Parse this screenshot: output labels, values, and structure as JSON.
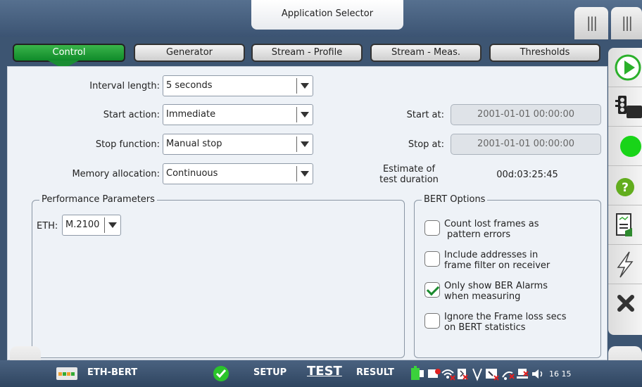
{
  "header": {
    "app_selector_label": "Application Selector",
    "grip_glyph": "|||"
  },
  "tabs": [
    {
      "label": "Control",
      "active": true
    },
    {
      "label": "Generator",
      "active": false
    },
    {
      "label": "Stream - Profile",
      "active": false
    },
    {
      "label": "Stream - Meas.",
      "active": false
    },
    {
      "label": "Thresholds",
      "active": false
    }
  ],
  "form": {
    "interval": {
      "label": "Interval length:",
      "value": "5 seconds"
    },
    "start_action": {
      "label": "Start action:",
      "value": "Immediate"
    },
    "stop_function": {
      "label": "Stop function:",
      "value": "Manual stop"
    },
    "memory": {
      "label": "Memory allocation:",
      "value": "Continuous"
    },
    "start_at": {
      "label": "Start at:",
      "value": "2001-01-01 00:00:00"
    },
    "stop_at": {
      "label": "Stop at:",
      "value": "2001-01-01 00:00:00"
    },
    "estimate": {
      "label_line1": "Estimate of",
      "label_line2": "test duration",
      "value": "00d:03:25:45"
    }
  },
  "performance": {
    "title": "Performance Parameters",
    "eth_label": "ETH:",
    "eth_value": "M.2100"
  },
  "bert": {
    "title": "BERT Options",
    "options": [
      {
        "line1": "Count lost frames as",
        "line2": "pattern errors",
        "checked": false
      },
      {
        "line1": "Include addresses in",
        "line2": "frame filter on receiver",
        "checked": false
      },
      {
        "line1": "Only show BER Alarms",
        "line2": "when measuring",
        "checked": true
      },
      {
        "line1": "Ignore the Frame loss secs",
        "line2": "on BERT statistics",
        "checked": false
      }
    ]
  },
  "sidebar": {
    "icons": [
      "play-icon",
      "traffic-light-icon",
      "status-led-icon",
      "help-icon",
      "report-icon",
      "lightning-icon",
      "close-icon"
    ],
    "play_color": "#2bb02b",
    "led_color": "#18d418",
    "help_color": "#62ad1e"
  },
  "bottom": {
    "left_nav": "(((",
    "right_nav": ")))",
    "app_name": "ETH-BERT",
    "setup": "SETUP",
    "test": "TEST",
    "result": "RESULT",
    "time": "16 15"
  }
}
